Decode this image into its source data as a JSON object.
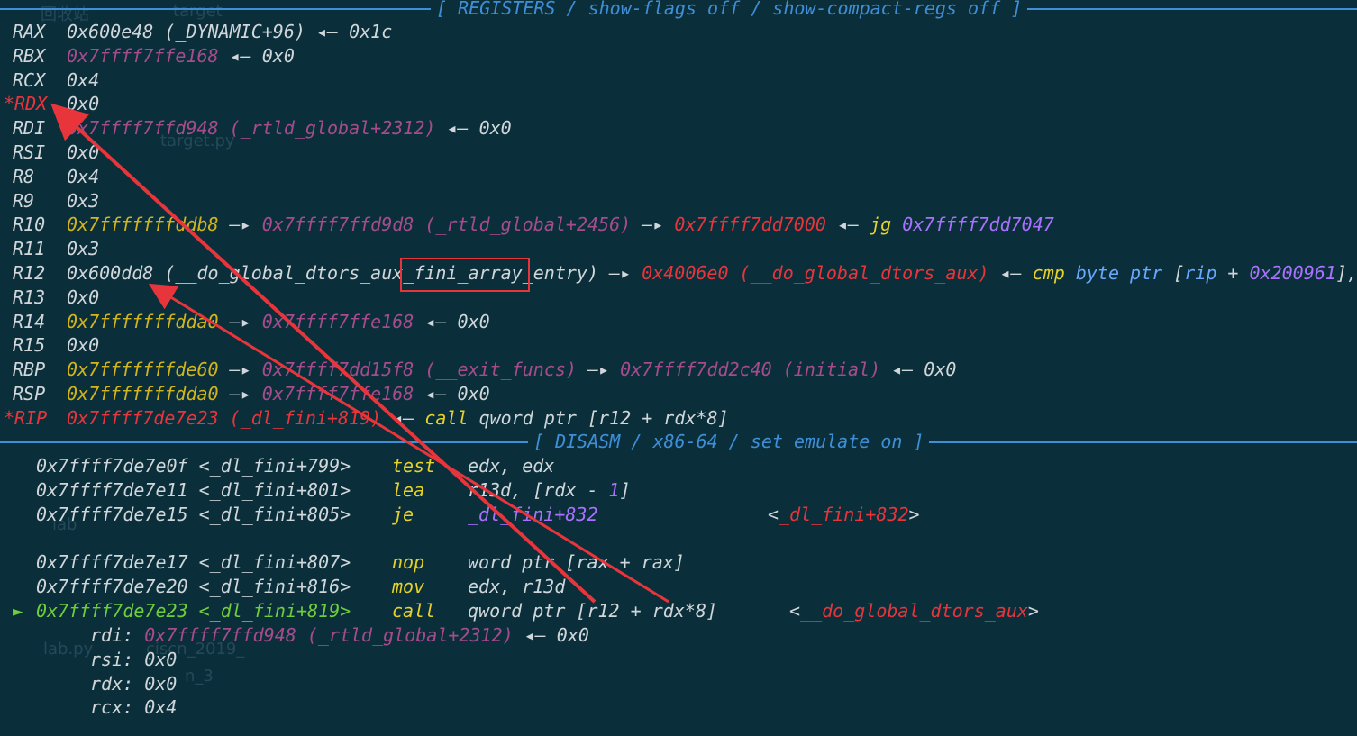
{
  "registers_header": "[ REGISTERS / show-flags off / show-compact-regs off ]",
  "disasm_header": "[ DISASM / x86-64 / set emulate on ]",
  "registers": [
    {
      "name": "RAX",
      "modified": false,
      "parts": [
        {
          "t": "0x600e48 (_DYNAMIC+96)",
          "c": "white"
        },
        {
          "t": " ◂— ",
          "c": "white"
        },
        {
          "t": "0x1c",
          "c": "white"
        }
      ]
    },
    {
      "name": "RBX",
      "modified": false,
      "parts": [
        {
          "t": "0x7ffff7ffe168",
          "c": "heap"
        },
        {
          "t": " ◂— ",
          "c": "white"
        },
        {
          "t": "0x0",
          "c": "white"
        }
      ]
    },
    {
      "name": "RCX",
      "modified": false,
      "parts": [
        {
          "t": "0x4",
          "c": "white"
        }
      ]
    },
    {
      "name": "*RDX",
      "modified": true,
      "parts": [
        {
          "t": "0x0",
          "c": "white"
        }
      ]
    },
    {
      "name": "RDI",
      "modified": false,
      "parts": [
        {
          "t": "0x7ffff7ffd948 (_rtld_global+2312)",
          "c": "heap"
        },
        {
          "t": " ◂— ",
          "c": "white"
        },
        {
          "t": "0x0",
          "c": "white"
        }
      ]
    },
    {
      "name": "RSI",
      "modified": false,
      "parts": [
        {
          "t": "0x0",
          "c": "white"
        }
      ]
    },
    {
      "name": "R8",
      "modified": false,
      "parts": [
        {
          "t": "0x4",
          "c": "white"
        }
      ]
    },
    {
      "name": "R9",
      "modified": false,
      "parts": [
        {
          "t": "0x3",
          "c": "white"
        }
      ]
    },
    {
      "name": "R10",
      "modified": false,
      "parts": [
        {
          "t": "0x7fffffffddb8",
          "c": "stack"
        },
        {
          "t": " —▸ ",
          "c": "white"
        },
        {
          "t": "0x7ffff7ffd9d8 (_rtld_global+2456)",
          "c": "heap"
        },
        {
          "t": " —▸ ",
          "c": "white"
        },
        {
          "t": "0x7ffff7dd7000",
          "c": "code"
        },
        {
          "t": " ◂— ",
          "c": "white"
        },
        {
          "t": "jg ",
          "c": "yellow"
        },
        {
          "t": "0x7ffff7dd7047",
          "c": "purple"
        }
      ]
    },
    {
      "name": "R11",
      "modified": false,
      "parts": [
        {
          "t": "0x3",
          "c": "white"
        }
      ]
    },
    {
      "name": "R12",
      "modified": false,
      "parts": [
        {
          "t": "0x600dd8 (__do_global_dtors_aux_fini_array_entry)",
          "c": "white"
        },
        {
          "t": " —▸ ",
          "c": "white"
        },
        {
          "t": "0x4006e0 (__do_global_dtors_aux)",
          "c": "code"
        },
        {
          "t": " ◂— ",
          "c": "white"
        },
        {
          "t": "cmp ",
          "c": "yellow"
        },
        {
          "t": "byte ptr ",
          "c": "blue"
        },
        {
          "t": "[",
          "c": "white"
        },
        {
          "t": "rip",
          "c": "blue"
        },
        {
          "t": " + ",
          "c": "white"
        },
        {
          "t": "0x200961",
          "c": "purple"
        },
        {
          "t": "],",
          "c": "white"
        }
      ]
    },
    {
      "name": "R13",
      "modified": false,
      "parts": [
        {
          "t": "0x0",
          "c": "white"
        }
      ]
    },
    {
      "name": "R14",
      "modified": false,
      "parts": [
        {
          "t": "0x7fffffffdda0",
          "c": "stack"
        },
        {
          "t": " —▸ ",
          "c": "white"
        },
        {
          "t": "0x7ffff7ffe168",
          "c": "heap"
        },
        {
          "t": " ◂— ",
          "c": "white"
        },
        {
          "t": "0x0",
          "c": "white"
        }
      ]
    },
    {
      "name": "R15",
      "modified": false,
      "parts": [
        {
          "t": "0x0",
          "c": "white"
        }
      ]
    },
    {
      "name": "RBP",
      "modified": false,
      "parts": [
        {
          "t": "0x7fffffffde60",
          "c": "stack"
        },
        {
          "t": " —▸ ",
          "c": "white"
        },
        {
          "t": "0x7ffff7dd15f8 (__exit_funcs)",
          "c": "heap"
        },
        {
          "t": " —▸ ",
          "c": "white"
        },
        {
          "t": "0x7ffff7dd2c40 (initial)",
          "c": "heap"
        },
        {
          "t": " ◂— ",
          "c": "white"
        },
        {
          "t": "0x0",
          "c": "white"
        }
      ]
    },
    {
      "name": "RSP",
      "modified": false,
      "parts": [
        {
          "t": "0x7fffffffdda0",
          "c": "stack"
        },
        {
          "t": " —▸ ",
          "c": "white"
        },
        {
          "t": "0x7ffff7ffe168",
          "c": "heap"
        },
        {
          "t": " ◂— ",
          "c": "white"
        },
        {
          "t": "0x0",
          "c": "white"
        }
      ]
    },
    {
      "name": "*RIP",
      "modified": true,
      "parts": [
        {
          "t": "0x7ffff7de7e23 (_dl_fini+819)",
          "c": "code"
        },
        {
          "t": " ◂— ",
          "c": "white"
        },
        {
          "t": "call ",
          "c": "yellow"
        },
        {
          "t": "qword ptr ",
          "c": "white"
        },
        {
          "t": "[r12 + rdx*8]",
          "c": "white"
        }
      ]
    }
  ],
  "disasm": [
    {
      "marker": "",
      "addr": "0x7ffff7de7e0f <_dl_fini+799>",
      "mnemonic": "test",
      "ops": [
        {
          "t": "edx",
          "c": "white"
        },
        {
          "t": ", ",
          "c": "white"
        },
        {
          "t": "edx",
          "c": "white"
        }
      ],
      "comment": []
    },
    {
      "marker": "",
      "addr": "0x7ffff7de7e11 <_dl_fini+801>",
      "mnemonic": "lea",
      "ops": [
        {
          "t": "r13d",
          "c": "white"
        },
        {
          "t": ", [",
          "c": "white"
        },
        {
          "t": "rdx",
          "c": "white"
        },
        {
          "t": " - ",
          "c": "white"
        },
        {
          "t": "1",
          "c": "purple"
        },
        {
          "t": "]",
          "c": "white"
        }
      ],
      "comment": []
    },
    {
      "marker": "",
      "addr": "0x7ffff7de7e15 <_dl_fini+805>",
      "mnemonic": "je",
      "ops": [
        {
          "t": "_dl_fini+832",
          "c": "purple"
        }
      ],
      "comment": [
        {
          "t": "<",
          "c": "white"
        },
        {
          "t": "_dl_fini+832",
          "c": "code"
        },
        {
          "t": ">",
          "c": "white"
        }
      ]
    },
    {
      "marker": "",
      "addr": "",
      "mnemonic": "",
      "ops": [],
      "comment": []
    },
    {
      "marker": "",
      "addr": "0x7ffff7de7e17 <_dl_fini+807>",
      "mnemonic": "nop",
      "ops": [
        {
          "t": "word ptr ",
          "c": "white"
        },
        {
          "t": "[rax + rax]",
          "c": "white"
        }
      ],
      "comment": []
    },
    {
      "marker": "",
      "addr": "0x7ffff7de7e20 <_dl_fini+816>",
      "mnemonic": "mov",
      "ops": [
        {
          "t": "edx",
          "c": "white"
        },
        {
          "t": ", ",
          "c": "white"
        },
        {
          "t": "r13d",
          "c": "white"
        }
      ],
      "comment": []
    },
    {
      "marker": "►",
      "addr": "0x7ffff7de7e23 <_dl_fini+819>",
      "mnemonic": "call",
      "ops": [
        {
          "t": "qword ptr ",
          "c": "white"
        },
        {
          "t": "[r12 + rdx*8]",
          "c": "white"
        }
      ],
      "comment": [
        {
          "t": "<",
          "c": "white"
        },
        {
          "t": "__do_global_dtors_aux",
          "c": "code"
        },
        {
          "t": ">",
          "c": "white"
        }
      ]
    }
  ],
  "call_args": [
    {
      "name": "rdi:",
      "parts": [
        {
          "t": "0x7ffff7ffd948 (_rtld_global+2312)",
          "c": "heap"
        },
        {
          "t": " ◂— ",
          "c": "white"
        },
        {
          "t": "0x0",
          "c": "white"
        }
      ]
    },
    {
      "name": "rsi:",
      "parts": [
        {
          "t": "0x0",
          "c": "white"
        }
      ]
    },
    {
      "name": "rdx:",
      "parts": [
        {
          "t": "0x0",
          "c": "white"
        }
      ]
    },
    {
      "name": "rcx:",
      "parts": [
        {
          "t": "0x4",
          "c": "white"
        }
      ]
    }
  ],
  "background_labels": [
    "回收站",
    "target",
    "target.py",
    "lab",
    "lab.py",
    "ciscn_2019_",
    "n_3"
  ],
  "annotation_color": "#e8353b"
}
